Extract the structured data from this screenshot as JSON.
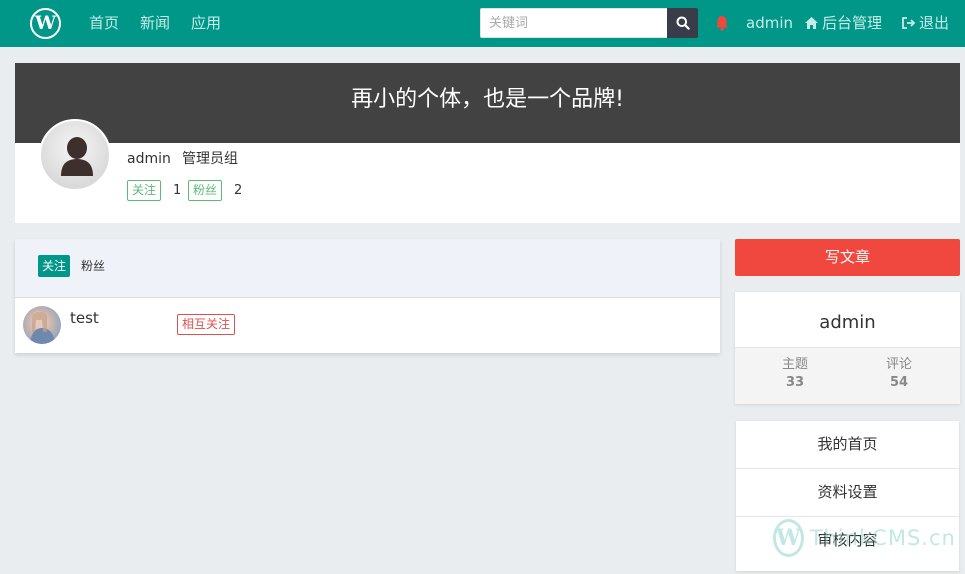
{
  "nav": {
    "logo": "W",
    "links": [
      "首页",
      "新闻",
      "应用"
    ],
    "search_placeholder": "关键词",
    "user": "admin",
    "admin_link": "后台管理",
    "logout": "退出"
  },
  "profile": {
    "slogan": "再小的个体，也是一个品牌!",
    "name": "admin",
    "group": "管理员组",
    "following_label": "关注",
    "following_count": "1",
    "fans_label": "粉丝",
    "fans_count": "2"
  },
  "list": {
    "tabs": [
      "关注",
      "粉丝"
    ],
    "rows": [
      {
        "name": "test",
        "relation": "相互关注"
      }
    ]
  },
  "sidebar": {
    "write_button": "写文章",
    "username": "admin",
    "stats": [
      {
        "label": "主题",
        "value": "33"
      },
      {
        "label": "评论",
        "value": "54"
      }
    ],
    "menu": [
      "我的首页",
      "资料设置",
      "审核内容"
    ]
  },
  "watermark": {
    "mark": "W",
    "text": "ThinkCMS.cn"
  },
  "colors": {
    "primary": "#009688",
    "banner": "#424242",
    "danger": "#f0483e",
    "success": "#5fb878"
  }
}
